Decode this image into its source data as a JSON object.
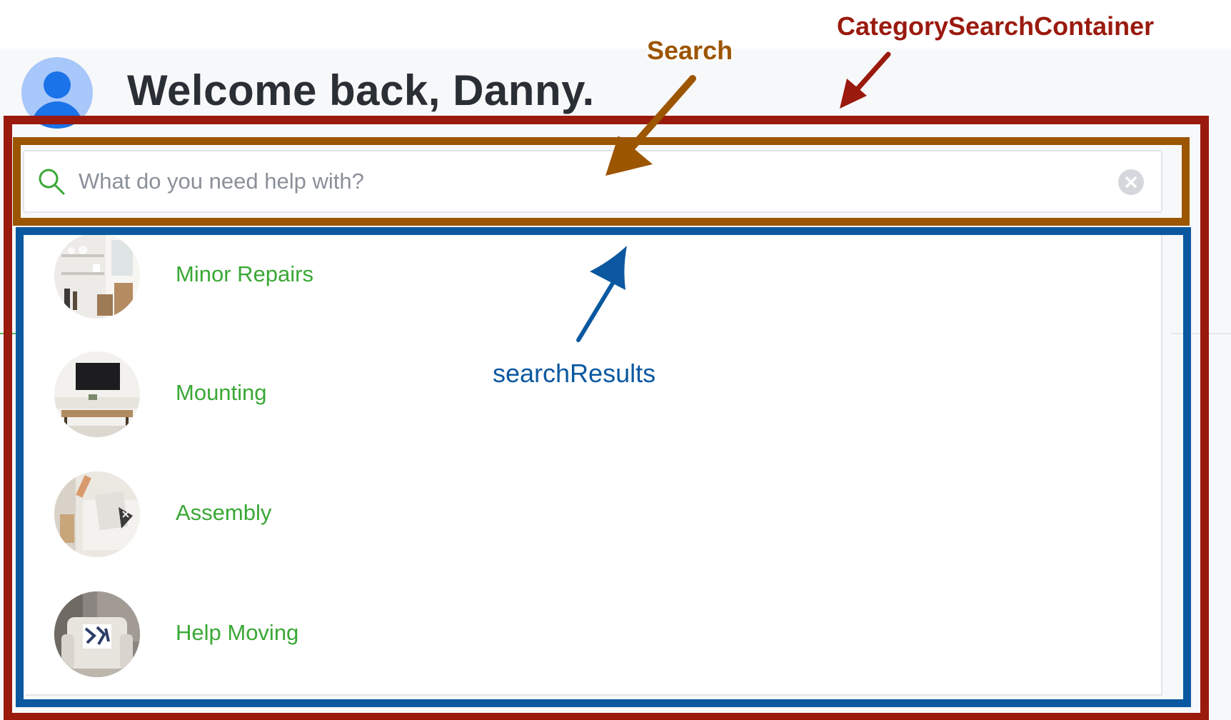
{
  "header": {
    "welcome_text": "Welcome back, Danny."
  },
  "search": {
    "placeholder": "What do you need help with?",
    "value": "",
    "search_icon": "search-icon",
    "clear_icon": "clear-icon"
  },
  "results": {
    "items": [
      {
        "label": "Minor Repairs",
        "thumb": "room-shelves-thumbnail"
      },
      {
        "label": "Mounting",
        "thumb": "tv-wall-thumbnail"
      },
      {
        "label": "Assembly",
        "thumb": "living-room-thumbnail"
      },
      {
        "label": "Help Moving",
        "thumb": "armchair-thumbnail"
      }
    ]
  },
  "annotations": {
    "container_label": "CategorySearchContainer",
    "search_label": "Search",
    "results_label": "searchResults"
  },
  "colors": {
    "container_box": "#9a1a0e",
    "search_box": "#9c5500",
    "results_box": "#0b58a0",
    "result_text": "#3aa835",
    "search_icon": "#3aa835",
    "avatar_bg": "#a8c7fa",
    "avatar_fg": "#1a73e8"
  }
}
